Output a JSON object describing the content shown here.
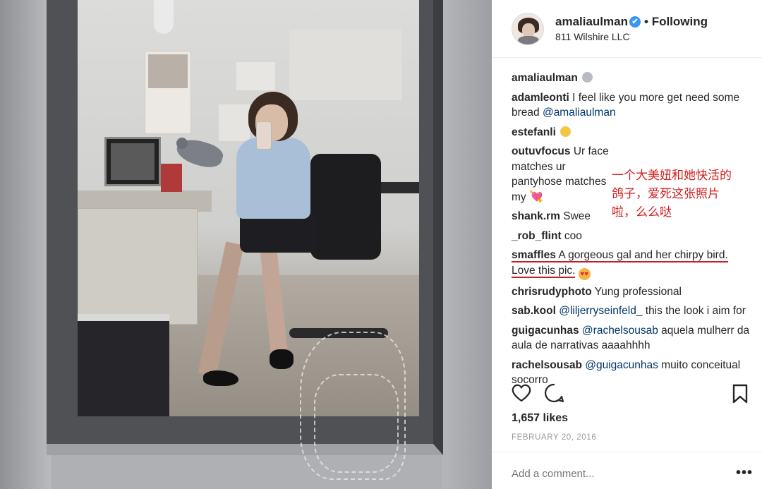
{
  "post": {
    "username": "amaliaulman",
    "follow_sep": "•",
    "follow_label": "Following",
    "location": "811 Wilshire LLC",
    "verified_icon": "✔"
  },
  "comments": [
    {
      "user": "amaliaulman",
      "text": "",
      "emoji": "pigeon-emoji"
    },
    {
      "user": "adamleonti",
      "text": " I feel like you more get need some bread ",
      "mention": "@amaliaulman"
    },
    {
      "user": "estefanli",
      "text": "",
      "emoji": "baby-chick-emoji"
    },
    {
      "user": "outuvfocus",
      "text": " Ur face matches ur pantyhose matches my ",
      "emoji": "💘"
    },
    {
      "user": "shank.rm",
      "text": " Swee"
    },
    {
      "user": "_rob_flint",
      "text": " coo"
    },
    {
      "user": "smaffles",
      "text": " A gorgeous gal and her chirpy bird. Love this pic.",
      "emoji": "heart-eyes-emoji"
    },
    {
      "user": "chrisrudyphoto",
      "text": " Yung professional"
    },
    {
      "user": "sab.kool",
      "mention": "@liljerryseinfeld_",
      "text": " this the look i aim for"
    },
    {
      "user": "guigacunhas",
      "mention": "@rachelsousab",
      "text": " aquela mulherr da aula de narrativas aaaahhhh"
    },
    {
      "user": "rachelsousab",
      "mention": "@guigacunhas",
      "text": " muito conceitual socorro"
    }
  ],
  "annotation": "一个大美妞和她快活的鸽子，爱死这张照片啦，么么哒",
  "likes": "1,657 likes",
  "date": "FEBRUARY 20, 2016",
  "add_comment_placeholder": "Add a comment...",
  "more_label": "•••",
  "colors": {
    "annotation_red": "#d11f1f",
    "verified_blue": "#3897f0",
    "mention_blue": "#003569"
  }
}
